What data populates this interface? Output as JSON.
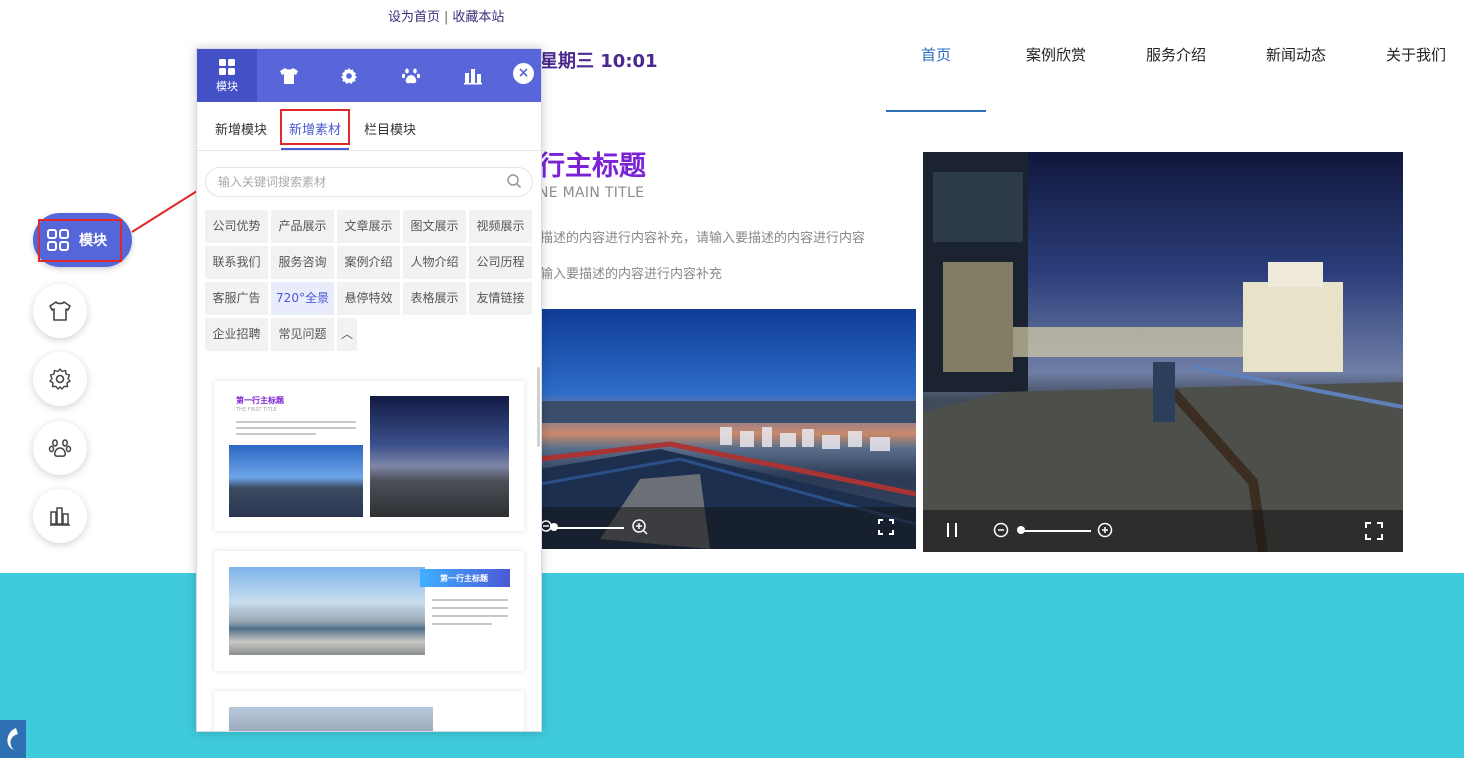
{
  "top_links": {
    "set_home": "设为首页",
    "separator": "|",
    "bookmark": "收藏本站"
  },
  "datetime": "星期三 10:01",
  "nav": {
    "items": [
      {
        "label": "首页",
        "active": true
      },
      {
        "label": "案例欣赏",
        "active": false
      },
      {
        "label": "服务介绍",
        "active": false
      },
      {
        "label": "新闻动态",
        "active": false
      },
      {
        "label": "关于我们",
        "active": false
      }
    ]
  },
  "content": {
    "title": "行主标题",
    "subtitle": "NE MAIN TITLE",
    "desc_line1": "描述的内容进行内容补充，请输入要描述的内容进行内容",
    "desc_line2": "输入要描述的内容进行内容补充"
  },
  "left_toolbar": {
    "active_label": "模块",
    "icons": [
      "grid-icon",
      "tshirt-icon",
      "gear-icon",
      "paw-icon",
      "books-icon"
    ]
  },
  "panel": {
    "header_tabs": [
      {
        "icon": "grid-icon",
        "label": "模块",
        "active": true
      },
      {
        "icon": "tshirt-icon",
        "label": "",
        "active": false
      },
      {
        "icon": "gear-icon",
        "label": "",
        "active": false
      },
      {
        "icon": "paw-icon",
        "label": "",
        "active": false
      },
      {
        "icon": "books-icon",
        "label": "",
        "active": false
      }
    ],
    "close_label": "×",
    "subtabs": [
      {
        "label": "新增模块",
        "active": false
      },
      {
        "label": "新增素材",
        "active": true
      },
      {
        "label": "栏目模块",
        "active": false
      }
    ],
    "search_placeholder": "输入关键词搜索素材",
    "tags": [
      [
        "公司优势",
        "产品展示",
        "文章展示",
        "图文展示",
        "视频展示"
      ],
      [
        "联系我们",
        "服务咨询",
        "案例介绍",
        "人物介绍",
        "公司历程"
      ],
      [
        "客服广告",
        "720°全景",
        "悬停特效",
        "表格展示",
        "友情链接"
      ],
      [
        "企业招聘",
        "常见问题",
        "︿"
      ]
    ],
    "active_tag": "720°全景",
    "cards": [
      {
        "mini_title": "第一行主标题",
        "mini_sub": "THE FIRST TITLE"
      },
      {
        "mini_title": "第一行主标题"
      }
    ]
  },
  "colors": {
    "accent": "#5966d9",
    "highlight_red": "#e02828",
    "title_purple": "#7b22d6",
    "nav_active": "#2d6fb8",
    "cyan_band": "#3fcbdc"
  }
}
